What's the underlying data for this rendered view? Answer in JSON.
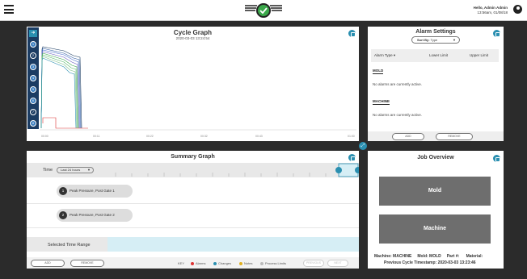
{
  "topbar": {
    "greeting": "Hello, Admin Admin",
    "datetime": "13:56am, 01/08/18"
  },
  "cycle_graph": {
    "title": "Cycle Graph",
    "subtitle": "2020-03-03  13:24:54",
    "gates": [
      "1",
      "2",
      "3",
      "4",
      "5",
      "6",
      "7",
      "8"
    ],
    "x_ticks": [
      "00:00",
      "00:11",
      "00:22",
      "00:32",
      "00:43",
      "01:00"
    ]
  },
  "alarm_settings": {
    "title": "Alarm Settings",
    "sort_label": "Sort By:",
    "sort_value": "Type",
    "columns": [
      "Alarm Type ▾",
      "Lower Limit",
      "Upper Limit"
    ],
    "sections": [
      {
        "name": "MOLD",
        "message": "No alarms are currently active."
      },
      {
        "name": "MACHINE",
        "message": "No alarms are currently active."
      }
    ],
    "add_label": "ADD",
    "remove_label": "REMOVE"
  },
  "summary_graph": {
    "title": "Summary Graph",
    "time_label": "Time",
    "time_select": "Last 24 hours",
    "rows": [
      {
        "num": "1",
        "label": "Peak Pressure, Post Gate 1"
      },
      {
        "num": "2",
        "label": "Peak Pressure, Post Gate 2"
      }
    ],
    "selected_time_range": "Selected Time Range",
    "add_label": "ADD",
    "remove_label": "REMOVE",
    "key_label": "KEY",
    "legend": [
      {
        "label": "Alarms",
        "color": "#d33"
      },
      {
        "label": "Changes",
        "color": "#2a8fb0"
      },
      {
        "label": "Notes",
        "color": "#e0b020"
      },
      {
        "label": "Process Limits",
        "color": "#bbb"
      }
    ],
    "previous_label": "PREVIOUS",
    "next_label": "NEXT"
  },
  "job_overview": {
    "title": "Job Overview",
    "mold_label": "Mold",
    "machine_label": "Machine",
    "info_line1": "Machine: MACHINE     Mold: MOLD     Part #:      Material:",
    "info_line2": "Previous Cycle Timestamp: 2020-03-03  13:23:46"
  }
}
